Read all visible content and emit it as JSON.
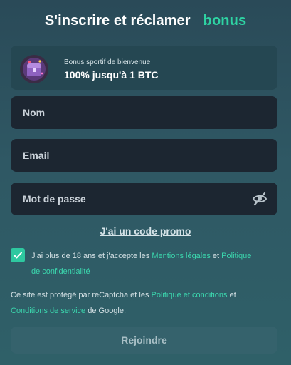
{
  "header": {
    "title": "S'inscrire et réclamer",
    "title_accent": "bonus",
    "accent_color": "#2ed3a3"
  },
  "bonus": {
    "icon": "treasure-chest-icon",
    "subtitle": "Bonus sportif de bienvenue",
    "headline": "100% jusqu'à 1 BTC"
  },
  "form": {
    "name_placeholder": "Nom",
    "email_placeholder": "Email",
    "password_placeholder": "Mot de passe",
    "password_toggle_icon": "eye-slash-icon"
  },
  "promo": {
    "label": "J'ai un code promo"
  },
  "consent": {
    "checked": true,
    "text_before": "J'ai plus de 18 ans et j'accepte les ",
    "link_legal": "Mentions légales",
    "text_and": " et ",
    "link_privacy": "Politique de confidentialité"
  },
  "recaptcha": {
    "text_before": "Ce site est protégé par reCaptcha et les ",
    "link_policy": "Politique et conditions",
    "text_and": " et ",
    "link_terms": "Conditions de service",
    "text_after": " de Google."
  },
  "submit": {
    "label": "Rejoindre"
  }
}
